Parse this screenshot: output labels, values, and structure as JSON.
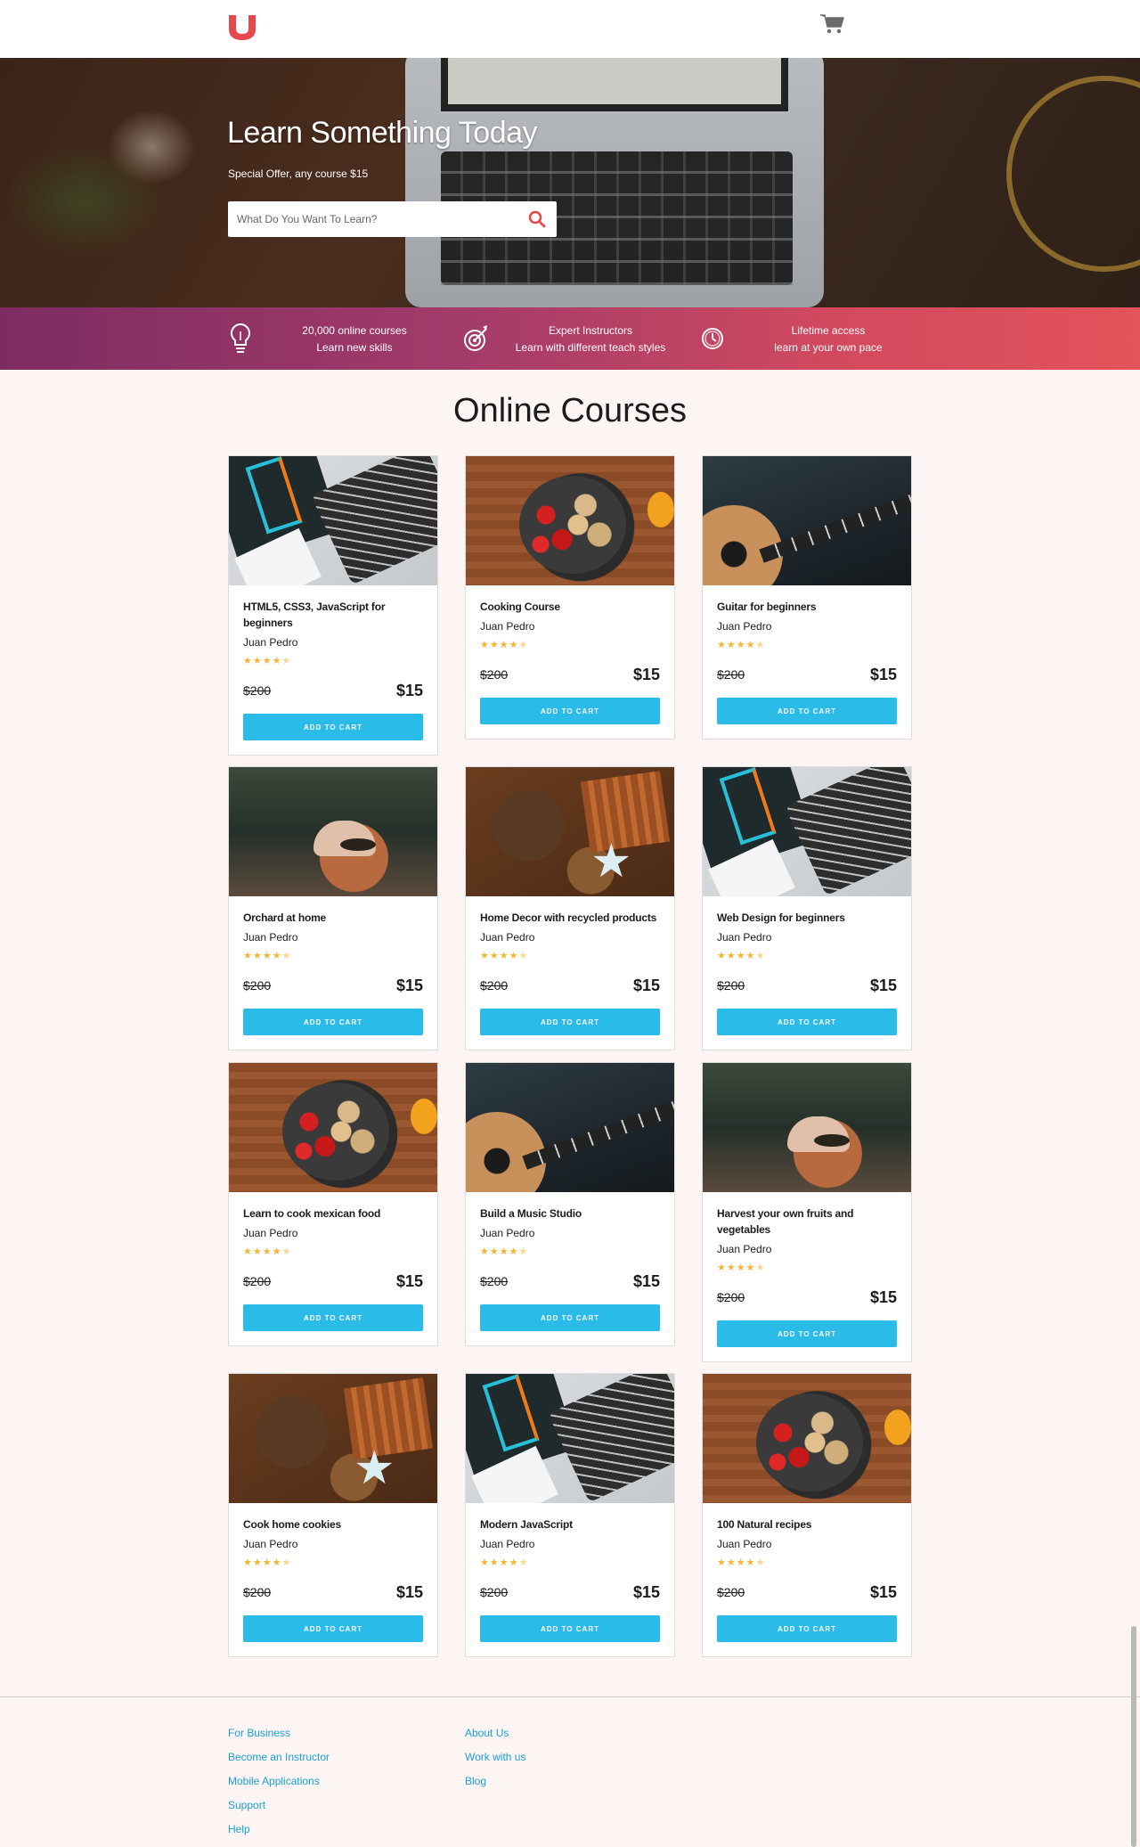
{
  "header": {
    "logo_letter": "u",
    "brand_color": "#e5484d"
  },
  "hero": {
    "title": "Learn Something Today",
    "subtitle": "Special Offer, any course $15",
    "search_placeholder": "What Do You Want To Learn?"
  },
  "features": [
    {
      "icon": "lightbulb-icon",
      "line1": "20,000 online courses",
      "line2": "Learn new skills"
    },
    {
      "icon": "target-icon",
      "line1": "Expert Instructors",
      "line2": "Learn with different teach styles"
    },
    {
      "icon": "clock-icon",
      "line1": "Lifetime access",
      "line2": "learn at your own pace"
    }
  ],
  "section_title": "Online Courses",
  "courses": [
    {
      "title": "HTML5, CSS3, JavaScript for beginners",
      "author": "Juan Pedro",
      "rating": 4.5,
      "old_price": "$200",
      "price": "$15",
      "button": "ADD TO CART",
      "image": "html"
    },
    {
      "title": "Cooking Course",
      "author": "Juan Pedro",
      "rating": 4.5,
      "old_price": "$200",
      "price": "$15",
      "button": "ADD TO CART",
      "image": "food"
    },
    {
      "title": "Guitar for beginners",
      "author": "Juan Pedro",
      "rating": 4.5,
      "old_price": "$200",
      "price": "$15",
      "button": "ADD TO CART",
      "image": "guitar"
    },
    {
      "title": "Orchard at home",
      "author": "Juan Pedro",
      "rating": 4.5,
      "old_price": "$200",
      "price": "$15",
      "button": "ADD TO CART",
      "image": "plant"
    },
    {
      "title": "Home Decor with recycled products",
      "author": "Juan Pedro",
      "rating": 4.5,
      "old_price": "$200",
      "price": "$15",
      "button": "ADD TO CART",
      "image": "decor"
    },
    {
      "title": "Web Design for beginners",
      "author": "Juan Pedro",
      "rating": 4.5,
      "old_price": "$200",
      "price": "$15",
      "button": "ADD TO CART",
      "image": "html"
    },
    {
      "title": "Learn to cook mexican food",
      "author": "Juan Pedro",
      "rating": 4.5,
      "old_price": "$200",
      "price": "$15",
      "button": "ADD TO CART",
      "image": "food"
    },
    {
      "title": "Build a Music Studio",
      "author": "Juan Pedro",
      "rating": 4.5,
      "old_price": "$200",
      "price": "$15",
      "button": "ADD TO CART",
      "image": "guitar"
    },
    {
      "title": "Harvest your own fruits and vegetables",
      "author": "Juan Pedro",
      "rating": 4.5,
      "old_price": "$200",
      "price": "$15",
      "button": "ADD TO CART",
      "image": "plant"
    },
    {
      "title": "Cook home cookies",
      "author": "Juan Pedro",
      "rating": 4.5,
      "old_price": "$200",
      "price": "$15",
      "button": "ADD TO CART",
      "image": "decor"
    },
    {
      "title": "Modern JavaScript",
      "author": "Juan Pedro",
      "rating": 4.5,
      "old_price": "$200",
      "price": "$15",
      "button": "ADD TO CART",
      "image": "html"
    },
    {
      "title": "100 Natural recipes",
      "author": "Juan Pedro",
      "rating": 4.5,
      "old_price": "$200",
      "price": "$15",
      "button": "ADD TO CART",
      "image": "food"
    }
  ],
  "footer": {
    "col1": [
      "For Business",
      "Become an Instructor",
      "Mobile Applications",
      "Support",
      "Help"
    ],
    "col2": [
      "About Us",
      "Work with us",
      "Blog"
    ]
  },
  "colors": {
    "accent_button": "#2bbbe9",
    "link": "#1a9ed8",
    "star": "#f2b632",
    "gradient_start": "#7d2c62",
    "gradient_end": "#e2535a"
  }
}
